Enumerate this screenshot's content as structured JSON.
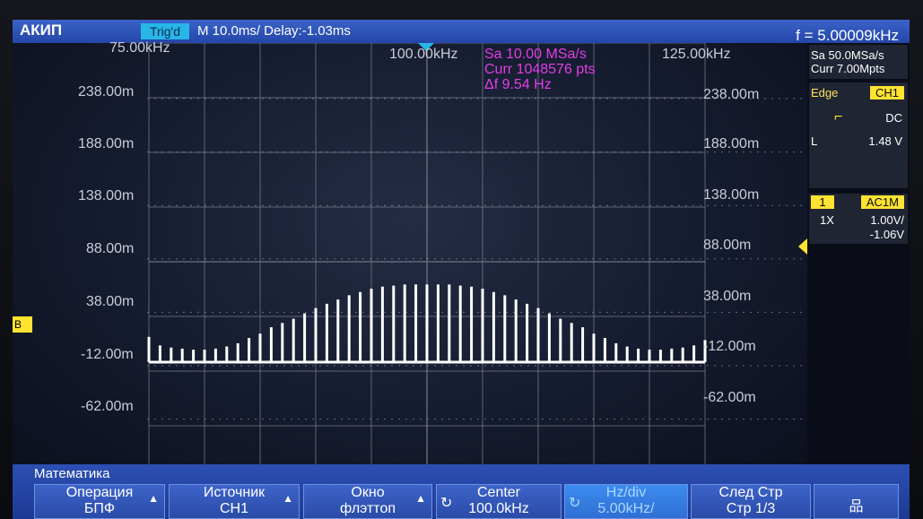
{
  "top": {
    "brand": "АКИП",
    "trigger": "Trig'd",
    "timebase": "M 10.0ms/ Delay:-1.03ms",
    "frequency": "f = 5.00009kHz"
  },
  "plot": {
    "freq_labels": [
      "75.00kHz",
      "100.00kHz",
      "125.00kHz"
    ],
    "left_scale": [
      "238.00m",
      "188.00m",
      "138.00m",
      "88.00m",
      "38.00m",
      "-12.00m",
      "-62.00m"
    ],
    "right_scale": [
      "238.00m",
      "188.00m",
      "138.00m",
      "88.00m",
      "38.00m",
      "-12.00m",
      "-62.00m"
    ],
    "fft_info": [
      "Sa 10.00 MSa/s",
      "Curr 1048576 pts",
      "Δf 9.54 Hz"
    ],
    "marker_b": "B"
  },
  "side": {
    "sa": "Sa 50.0MSa/s",
    "curr": "Curr 7.00Mpts",
    "edge": "Edge",
    "ch": "CH1",
    "dc": "DC",
    "l": "L",
    "level": "1.48 V",
    "num": "1",
    "acm": "AC1M",
    "probe": "1X",
    "vdiv": "1.00V/",
    "offset": "-1.06V"
  },
  "softkeys": {
    "title": "Математика",
    "k1": [
      "Операция",
      "БПФ"
    ],
    "k2": [
      "Источник",
      "CH1"
    ],
    "k3": [
      "Окно",
      "флэттоп"
    ],
    "k4": [
      "Center",
      "100.0kHz"
    ],
    "k5": [
      "Hz/div",
      "5.00kHz/"
    ],
    "k6": [
      "След Стр",
      "Стр 1/3"
    ]
  },
  "colors": {
    "trace": "#ffffff",
    "grid": "#8a8f9a",
    "fft_text": "#e23ee6",
    "highlight": "#ffe330",
    "topbar": "#2e54b8"
  },
  "chart_data": {
    "type": "bar",
    "title": "",
    "xlabel": "",
    "ylabel": "",
    "x_unit": "kHz",
    "xlim": [
      75,
      125
    ],
    "y_unit": "m",
    "ylim": [
      -62,
      238
    ],
    "categories": [
      75,
      76,
      77,
      78,
      79,
      80,
      81,
      82,
      83,
      84,
      85,
      86,
      87,
      88,
      89,
      90,
      91,
      92,
      93,
      94,
      95,
      96,
      97,
      98,
      99,
      100,
      101,
      102,
      103,
      104,
      105,
      106,
      107,
      108,
      109,
      110,
      111,
      112,
      113,
      114,
      115,
      116,
      117,
      118,
      119,
      120,
      121,
      122,
      123,
      124,
      125
    ],
    "values": [
      15,
      7,
      5,
      4,
      3,
      3,
      4,
      6,
      9,
      14,
      18,
      24,
      28,
      32,
      37,
      42,
      46,
      50,
      54,
      57,
      60,
      62,
      63,
      64,
      64,
      64,
      64,
      64,
      63,
      62,
      60,
      57,
      54,
      50,
      46,
      42,
      37,
      32,
      28,
      24,
      18,
      14,
      9,
      6,
      4,
      3,
      3,
      4,
      5,
      7,
      12
    ]
  }
}
